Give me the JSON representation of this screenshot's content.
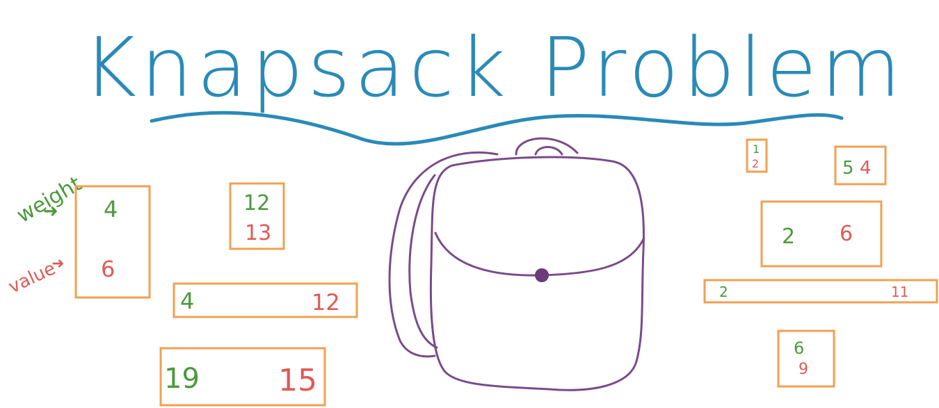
{
  "title": "Knapsack Problem",
  "legend": {
    "weight_label": "weight",
    "value_label": "value"
  },
  "colors": {
    "title": "#2a8ab8",
    "box": "#f0a050",
    "weight": "#4a9a3a",
    "value": "#e05a55",
    "backpack": "#7a4a8a"
  },
  "items_left": [
    {
      "weight": "4",
      "value": "6"
    },
    {
      "weight": "12",
      "value": "13"
    },
    {
      "weight": "4",
      "value": "12"
    },
    {
      "weight": "19",
      "value": "15"
    }
  ],
  "items_right": [
    {
      "weight": "1",
      "value": "2"
    },
    {
      "weight": "5",
      "value": "4"
    },
    {
      "weight": "2",
      "value": "6"
    },
    {
      "weight": "2",
      "value": "11"
    },
    {
      "weight": "6",
      "value": "9"
    }
  ]
}
